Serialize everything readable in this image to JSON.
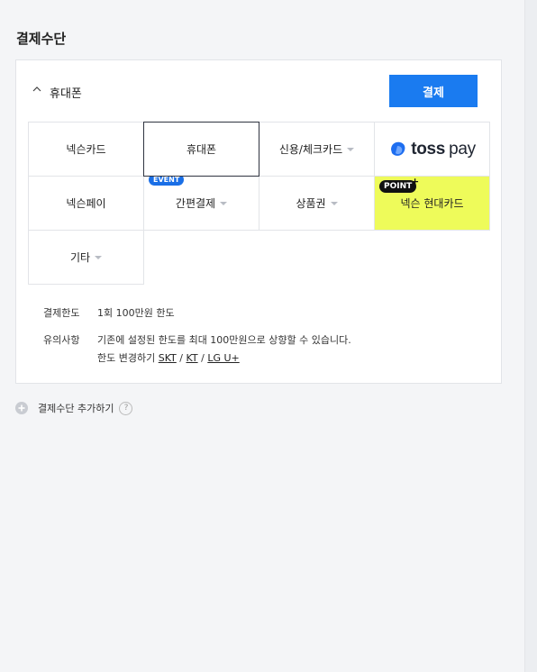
{
  "section": {
    "title": "결제수단"
  },
  "panel": {
    "header_label": "휴대폰",
    "pay_button": "결제",
    "methods": [
      {
        "label": "넥슨카드",
        "caret": false
      },
      {
        "label": "휴대폰",
        "caret": false,
        "selected": true
      },
      {
        "label": "신용/체크카드",
        "caret": true
      },
      {
        "label": "toss pay",
        "logo": "toss-logo"
      },
      {
        "label": "넥슨페이",
        "caret": false
      },
      {
        "label": "간편결제",
        "caret": true,
        "badge": "EVENT"
      },
      {
        "label": "상품권",
        "caret": true
      },
      {
        "label": "넥슨 현대카드",
        "badge": "POINT",
        "badge_suffix": "+",
        "highlight": true
      },
      {
        "label": "기타",
        "caret": true
      }
    ],
    "info": {
      "limit_label": "결제한도",
      "limit_value": "1회 100만원 한도",
      "notice_label": "유의사항",
      "notice_line1": "기존에 설정된 한도를 최대 100만원으로 상향할 수 있습니다.",
      "notice_line2_prefix": "한도 변경하기",
      "links": [
        "SKT",
        "KT",
        "LG U+"
      ],
      "separator": "/"
    }
  },
  "add_method": {
    "label": "결제수단 추가하기",
    "help": "?"
  },
  "colors": {
    "accent": "#1a7bf0",
    "event_badge": "#1a6fe6",
    "highlight": "#eefb5a",
    "toss_blue": "#1e6ef0"
  },
  "icons": [
    "chevron-up-icon",
    "caret-down-icon",
    "plus-circle-icon",
    "question-icon",
    "toss-logo-icon"
  ]
}
